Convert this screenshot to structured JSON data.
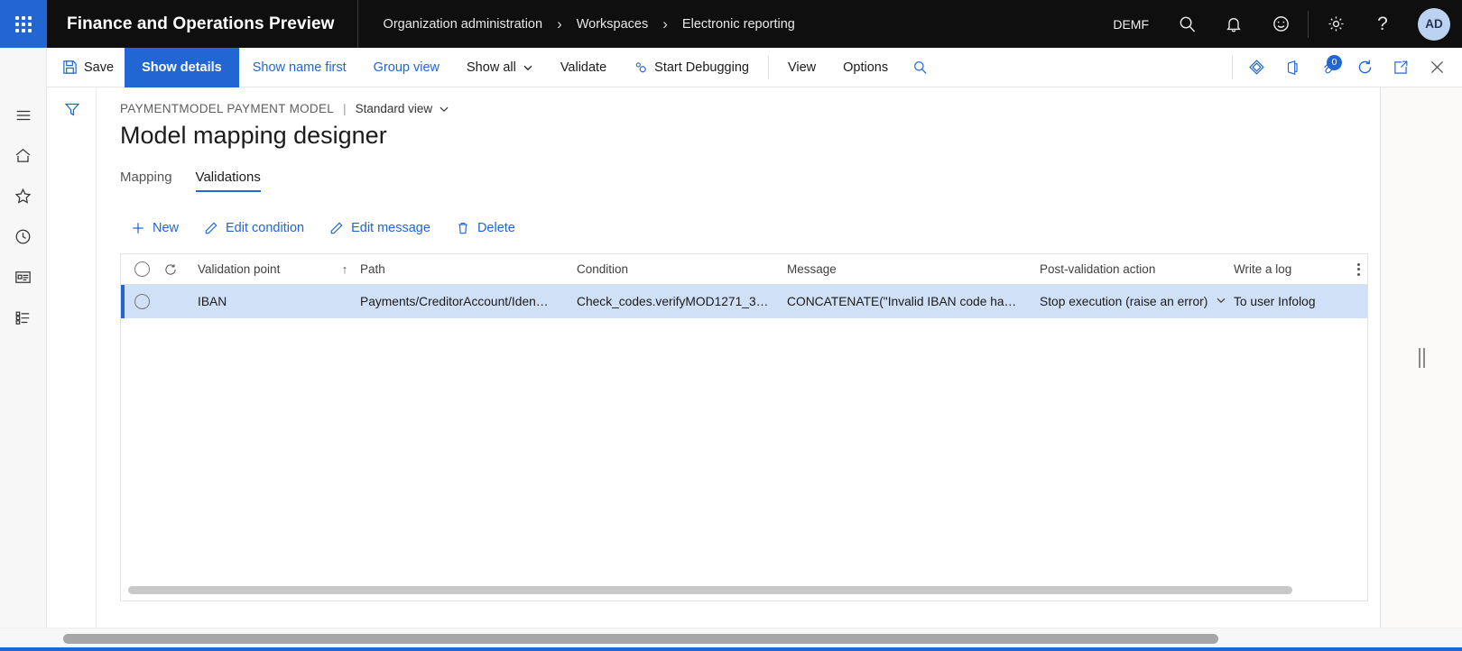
{
  "topnav": {
    "waffle_label": "app-launcher",
    "app_title": "Finance and Operations Preview",
    "breadcrumb": [
      {
        "label": "Organization administration"
      },
      {
        "label": "Workspaces"
      },
      {
        "label": "Electronic reporting"
      }
    ],
    "separator": "›",
    "legal_entity": "DEMF",
    "icons": [
      {
        "name": "search-icon",
        "glyph": "⌕"
      },
      {
        "name": "notifications-bell-icon",
        "glyph": "🔔"
      },
      {
        "name": "feedback-smiley-icon",
        "glyph": "☺"
      },
      {
        "name": "settings-gear-icon",
        "glyph": "⚙"
      },
      {
        "name": "help-question-icon",
        "glyph": "?"
      }
    ],
    "avatar_initials": "AD"
  },
  "commandbar": {
    "save_label": "Save",
    "show_details_label": "Show details",
    "show_name_first_label": "Show name first",
    "group_view_label": "Group view",
    "show_all_label": "Show all",
    "validate_label": "Validate",
    "start_debugging_label": "Start Debugging",
    "view_label": "View",
    "options_label": "Options",
    "attachments_count": "0"
  },
  "rail": {
    "items": [
      {
        "name": "navigation-menu-icon"
      },
      {
        "name": "home-icon"
      },
      {
        "name": "favorites-star-icon"
      },
      {
        "name": "recent-clock-icon"
      },
      {
        "name": "workspaces-icon"
      },
      {
        "name": "modules-list-icon"
      }
    ]
  },
  "page": {
    "caption_main": "PAYMENTMODEL PAYMENT MODEL",
    "caption_bar": "|",
    "caption_view": "Standard view",
    "title": "Model mapping designer"
  },
  "tabs": [
    {
      "label": "Mapping",
      "active": false
    },
    {
      "label": "Validations",
      "active": true
    }
  ],
  "gridtools": [
    {
      "name": "new-button",
      "label": "New",
      "icon": "plus-icon"
    },
    {
      "name": "edit-condition-button",
      "label": "Edit condition",
      "icon": "pencil-icon"
    },
    {
      "name": "edit-message-button",
      "label": "Edit message",
      "icon": "pencil-icon"
    },
    {
      "name": "delete-button",
      "label": "Delete",
      "icon": "trash-icon"
    }
  ],
  "grid": {
    "columns": [
      {
        "label": "Validation point",
        "sort": "↑"
      },
      {
        "label": "Path"
      },
      {
        "label": "Condition"
      },
      {
        "label": "Message"
      },
      {
        "label": "Post-validation action"
      },
      {
        "label": "Write a log"
      }
    ],
    "rows": [
      {
        "validation_point": "IBAN",
        "path": "Payments/CreditorAccount/Iden…",
        "condition": "Check_codes.verifyMOD1271_3…",
        "message": "CONCATENATE(\"Invalid IBAN code ha…",
        "post_validation_action": "Stop execution (raise an error)",
        "write_a_log": "To user Infolog"
      }
    ]
  },
  "colors": {
    "accent": "#2266d3",
    "topnav_bg": "#0f0f0f",
    "row_selected_bg": "#cfe0f7"
  }
}
